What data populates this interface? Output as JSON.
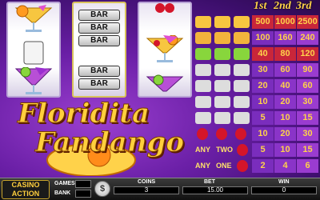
{
  "paytable": {
    "headers": [
      "1st",
      "2nd",
      "3rd"
    ],
    "rows": [
      {
        "symbol": "cocktail-orange",
        "values": [
          "500",
          "1000",
          "2500"
        ]
      },
      {
        "symbol": "cocktail-cherry",
        "values": [
          "100",
          "160",
          "240"
        ]
      },
      {
        "symbol": "any-cocktail",
        "values": [
          "40",
          "80",
          "120"
        ]
      },
      {
        "symbol": "triple-bar",
        "values": [
          "30",
          "60",
          "90"
        ]
      },
      {
        "symbol": "double-bar",
        "values": [
          "20",
          "40",
          "60"
        ]
      },
      {
        "symbol": "single-bar",
        "values": [
          "10",
          "20",
          "30"
        ]
      },
      {
        "symbol": "any-bar",
        "values": [
          "5",
          "10",
          "15"
        ]
      },
      {
        "symbol": "cherry-three",
        "values": [
          "10",
          "20",
          "30"
        ]
      },
      {
        "symbol": "any-two-cherry",
        "values": [
          "5",
          "10",
          "15"
        ]
      },
      {
        "symbol": "any-one-cherry",
        "values": [
          "2",
          "4",
          "6"
        ]
      }
    ],
    "any_text": [
      "ANY",
      "ANY",
      "ANY",
      "TWO",
      "ANY",
      "ONE"
    ],
    "bar_text": "BAR"
  },
  "reels": {
    "bar_label": "BAR"
  },
  "logo": {
    "line1": "Floridita",
    "line2": "Fandango"
  },
  "bottom": {
    "casino_logo_line1": "CASINO",
    "casino_logo_line2": "ACTION",
    "games_label": "GAMES",
    "bank_label": "BANK",
    "coin_symbol": "$",
    "coins_label": "COINS",
    "coins_value": "3",
    "bet_label": "BET",
    "bet_value": "15.00",
    "win_label": "WIN",
    "win_value": "0"
  },
  "colors": {
    "gold": "#ffd24a",
    "purple_bg": "#6a1fa6",
    "highlight_red": "#c9263a"
  }
}
